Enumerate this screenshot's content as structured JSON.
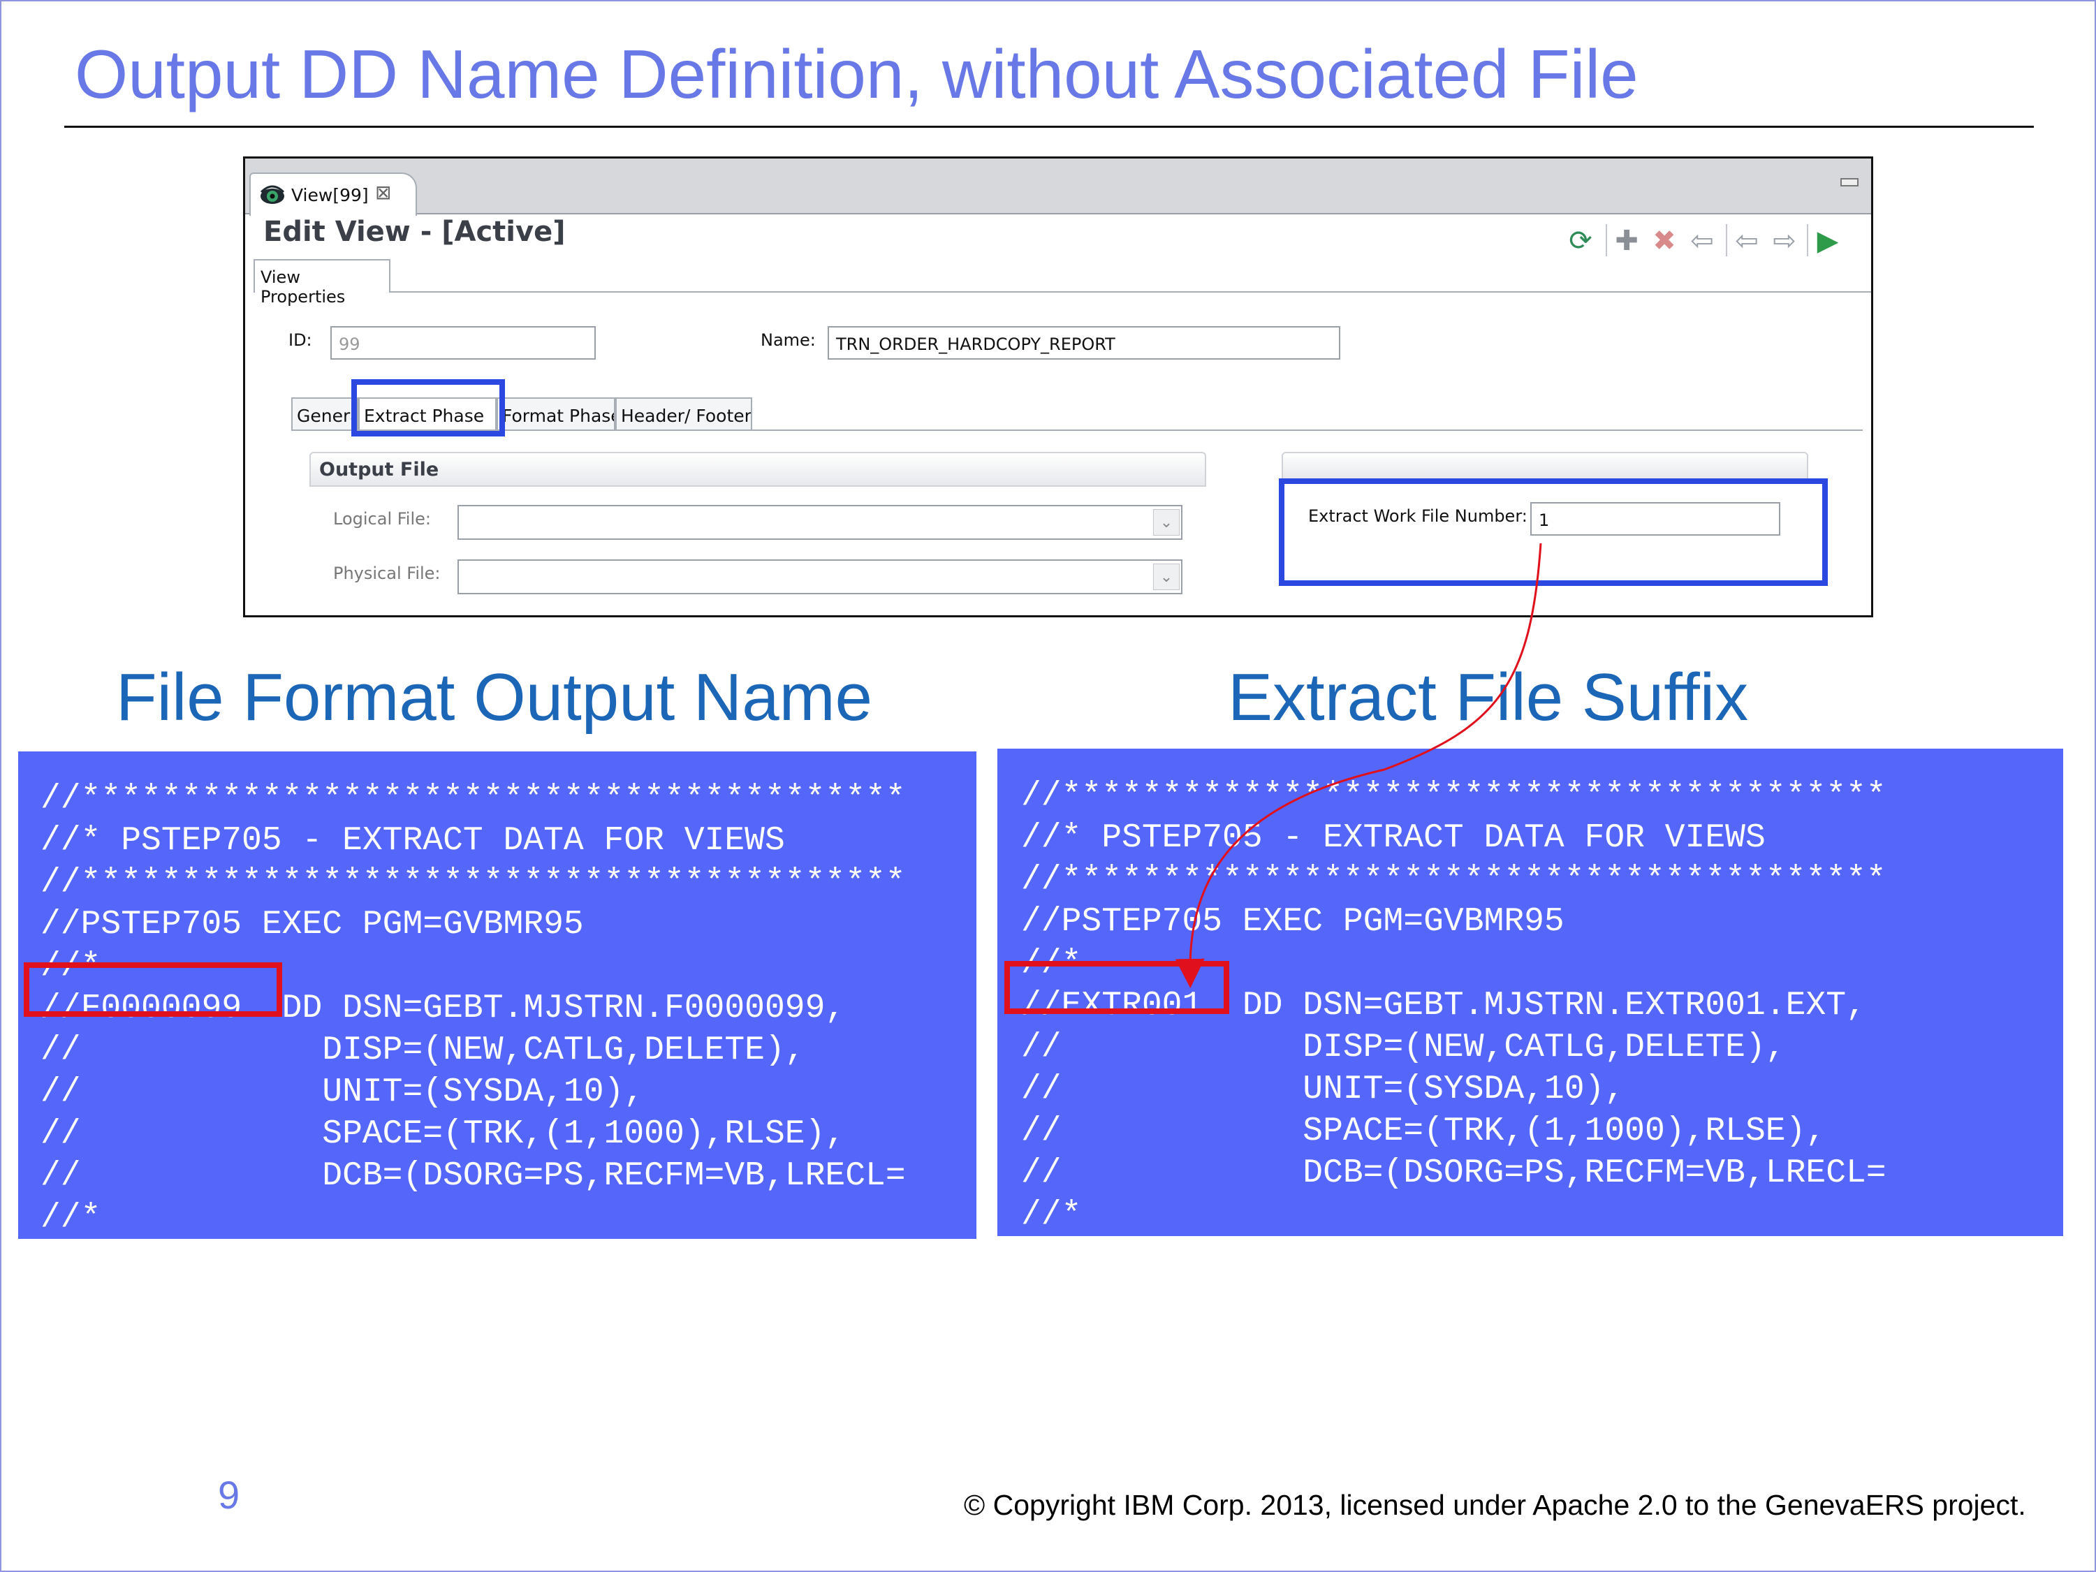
{
  "slide": {
    "title": "Output DD Name Definition, without Associated File",
    "page_number": "9",
    "copyright": "© Copyright IBM Corp. 2013, licensed under Apache 2.0 to the GenevaERS project."
  },
  "screenshot": {
    "tab_label": "View[99]",
    "editor_title": "Edit View - [Active]",
    "properties_tab": "View Properties",
    "id_label": "ID:",
    "id_value": "99",
    "name_label": "Name:",
    "name_value": "TRN_ORDER_HARDCOPY_REPORT",
    "subtabs": {
      "general": "General",
      "extract_phase": "Extract Phase",
      "format_phase": "Format Phase",
      "header_footer": "Header/ Footer"
    },
    "output_file_group": "Output File",
    "logical_file_label": "Logical File:",
    "logical_file_value": "",
    "physical_file_label": "Physical File:",
    "physical_file_value": "",
    "extract_work_file_label": "Extract Work File Number:",
    "extract_work_file_value": "1",
    "toolbar_icons": [
      "refresh-icon",
      "add-icon",
      "delete-icon",
      "undo-icon",
      "back-icon",
      "forward-icon",
      "run-icon"
    ],
    "highlight_color": "#2b48e0"
  },
  "left_section": {
    "heading": "File Format Output Name",
    "highlight_color": "#e0101c",
    "lines": [
      "//*****************************************",
      "//* PSTEP705 - EXTRACT DATA FOR VIEWS",
      "//*****************************************",
      "//PSTEP705 EXEC PGM=GVBMR95",
      "//*",
      "//F0000099  DD DSN=GEBT.MJSTRN.F0000099,",
      "//            DISP=(NEW,CATLG,DELETE),",
      "//            UNIT=(SYSDA,10),",
      "//            SPACE=(TRK,(1,1000),RLSE),",
      "//            DCB=(DSORG=PS,RECFM=VB,LRECL=",
      "//*"
    ]
  },
  "right_section": {
    "heading": "Extract File Suffix",
    "highlight_color": "#e0101c",
    "lines": [
      "//*****************************************",
      "//* PSTEP705 - EXTRACT DATA FOR VIEWS",
      "//*****************************************",
      "//PSTEP705 EXEC PGM=GVBMR95",
      "//*",
      "//EXTR001  DD DSN=GEBT.MJSTRN.EXTR001.EXT,",
      "//            DISP=(NEW,CATLG,DELETE),",
      "//            UNIT=(SYSDA,10),",
      "//            SPACE=(TRK,(1,1000),RLSE),",
      "//            DCB=(DSORG=PS,RECFM=VB,LRECL=",
      "//*"
    ]
  },
  "code_background": "#5566fa",
  "arrow_color": "#e0101c"
}
